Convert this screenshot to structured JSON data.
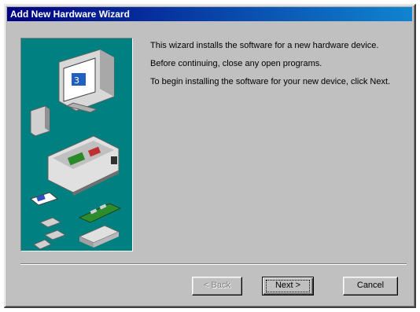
{
  "window": {
    "title": "Add New Hardware Wizard"
  },
  "content": {
    "paragraphs": [
      "This wizard installs the software for a new hardware device.",
      "Before continuing, close any open programs.",
      "To begin installing the software for your new device, click Next."
    ]
  },
  "buttons": {
    "back_label": "< Back",
    "next_label": "Next >",
    "cancel_label": "Cancel"
  },
  "colors": {
    "title_bar": "#000080",
    "illustration_bg": "#008080",
    "dialog_bg": "#c0c0c0"
  }
}
